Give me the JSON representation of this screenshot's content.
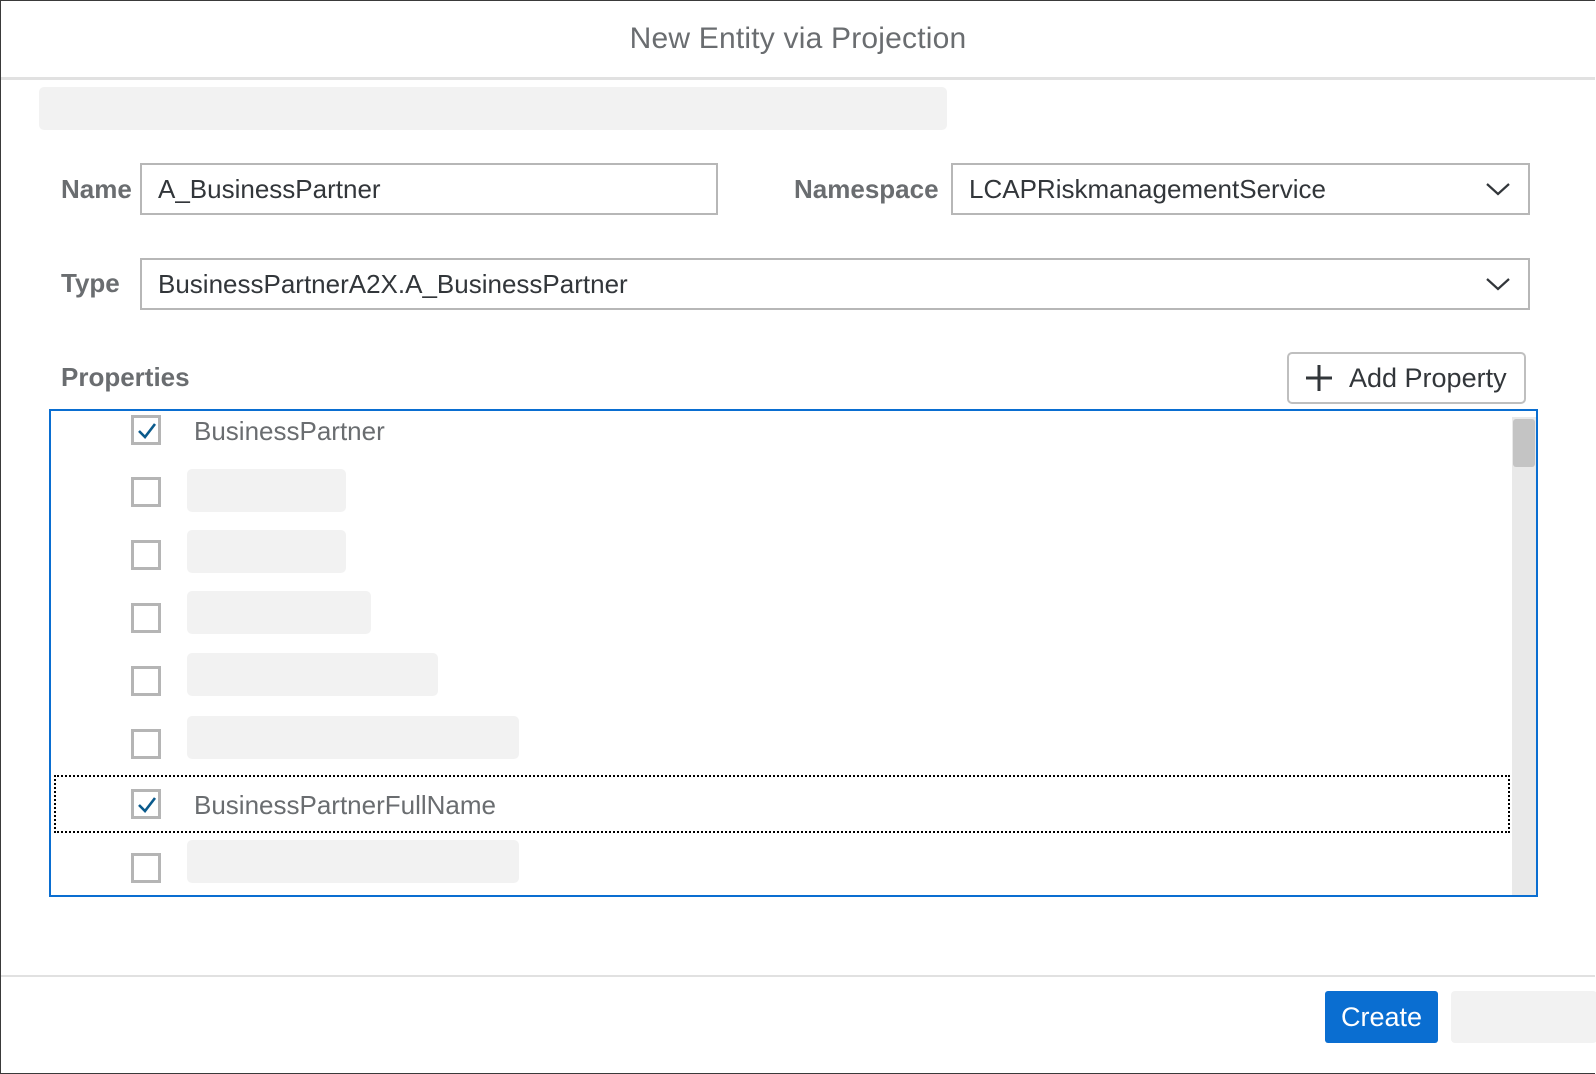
{
  "dialog": {
    "title": "New Entity via Projection"
  },
  "form": {
    "name_label": "Name",
    "name_value": "A_BusinessPartner",
    "namespace_label": "Namespace",
    "namespace_value": "LCAPRiskmanagementService",
    "type_label": "Type",
    "type_value": "BusinessPartnerA2X.A_BusinessPartner"
  },
  "properties": {
    "label": "Properties",
    "add_button_label": "Add Property",
    "items": [
      {
        "label": "BusinessPartner",
        "checked": true
      },
      {
        "label": "",
        "checked": false
      },
      {
        "label": "",
        "checked": false
      },
      {
        "label": "",
        "checked": false
      },
      {
        "label": "",
        "checked": false
      },
      {
        "label": "",
        "checked": false
      },
      {
        "label": "BusinessPartnerFullName",
        "checked": true
      },
      {
        "label": "",
        "checked": false
      }
    ]
  },
  "footer": {
    "create_label": "Create"
  },
  "colors": {
    "accent": "#0a6ed1",
    "check": "#0a5a8c"
  }
}
